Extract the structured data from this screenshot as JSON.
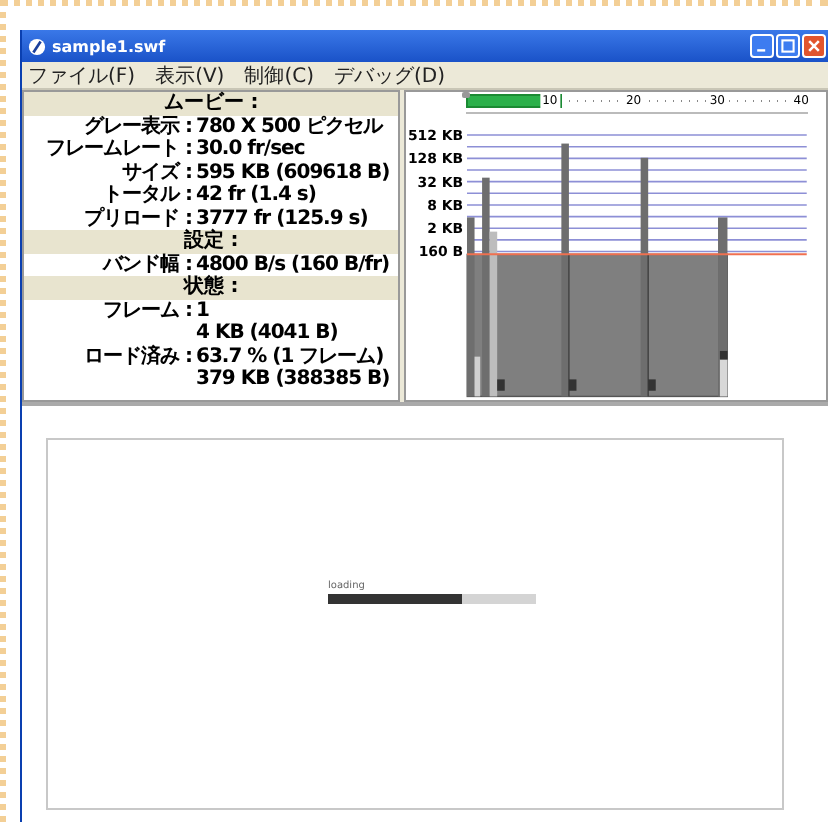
{
  "window": {
    "title": "sample1.swf"
  },
  "menu": [
    "ファイル(F)",
    "表示(V)",
    "制御(C)",
    "デバッグ(D)"
  ],
  "properties": [
    {
      "kind": "heading",
      "text": "ムービー :"
    },
    {
      "kind": "row",
      "label": "グレー表示 :",
      "value": "780 X 500 ピクセル"
    },
    {
      "kind": "row",
      "label": "フレームレート :",
      "value": "30.0 fr/sec"
    },
    {
      "kind": "row",
      "label": "サイズ :",
      "value": "595 KB (609618 B)"
    },
    {
      "kind": "row",
      "label": "トータル :",
      "value": "42 fr (1.4 s)"
    },
    {
      "kind": "row",
      "label": "プリロード :",
      "value": "3777 fr (125.9 s)"
    },
    {
      "kind": "heading",
      "text": "設定 :"
    },
    {
      "kind": "row",
      "label": "バンド幅 :",
      "value": "4800 B/s (160 B/fr)"
    },
    {
      "kind": "heading",
      "text": "状態 :"
    },
    {
      "kind": "row",
      "label": "フレーム :",
      "value": "1"
    },
    {
      "kind": "row",
      "value": "4 KB (4041 B)"
    },
    {
      "kind": "row",
      "label": "ロード済み :",
      "value": "63.7 % (1 フレーム)"
    },
    {
      "kind": "row",
      "value": "379 KB (388385 B)"
    }
  ],
  "timeline": {
    "level": 0.28,
    "marks": [
      "10",
      "20",
      "30",
      "40"
    ]
  },
  "graph": {
    "axis_labels": [
      "512 KB",
      "128 KB",
      "32 KB",
      "8 KB",
      "2 KB",
      "160 B"
    ]
  },
  "loader": {
    "label": "loading",
    "level": 0.64
  }
}
